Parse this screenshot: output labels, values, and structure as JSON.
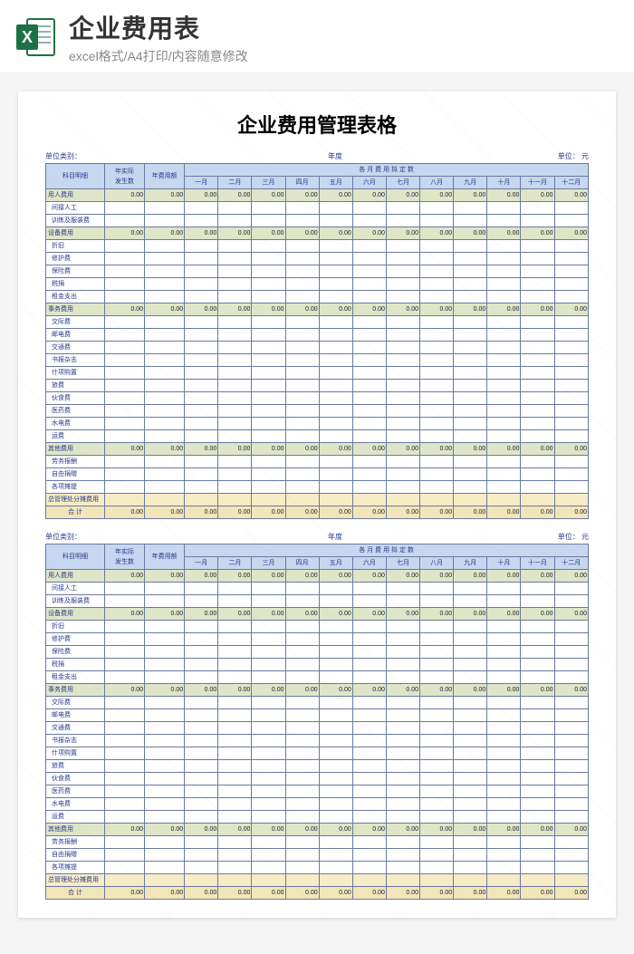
{
  "header": {
    "icon_label": "X",
    "main_title": "企业费用表",
    "sub_title": "excel格式/A4打印/内容随意修改"
  },
  "doc_title": "企业费用管理表格",
  "meta": {
    "unit_label": "单位类别：",
    "year_label": "年度",
    "currency_label": "单位：    元"
  },
  "columns": {
    "item": "科目明细",
    "actual": "年实际\n发生数",
    "budget": "年费用额",
    "months_group": "各 月 费 用 拟 定 数",
    "months": [
      "一月",
      "二月",
      "三月",
      "四月",
      "五月",
      "六月",
      "七月",
      "八月",
      "九月",
      "十月",
      "十一月",
      "十二月"
    ]
  },
  "zero": "0.00",
  "rows": [
    {
      "type": "section",
      "name": "用人费用",
      "zero": true
    },
    {
      "type": "detail",
      "name": "间接人工"
    },
    {
      "type": "detail",
      "name": "训练及服装费"
    },
    {
      "type": "section",
      "name": "设备费用",
      "zero": true
    },
    {
      "type": "detail",
      "name": "折旧"
    },
    {
      "type": "detail",
      "name": "修护费"
    },
    {
      "type": "detail",
      "name": "保险费"
    },
    {
      "type": "detail",
      "name": "税捐"
    },
    {
      "type": "detail",
      "name": "租金支出"
    },
    {
      "type": "section",
      "name": "事务费用",
      "zero": true
    },
    {
      "type": "detail",
      "name": "交际费"
    },
    {
      "type": "detail",
      "name": "邮电费"
    },
    {
      "type": "detail",
      "name": "交通费"
    },
    {
      "type": "detail",
      "name": "书报杂志"
    },
    {
      "type": "detail",
      "name": "什项购置"
    },
    {
      "type": "detail",
      "name": "旅费"
    },
    {
      "type": "detail",
      "name": "伙食费"
    },
    {
      "type": "detail",
      "name": "医药费"
    },
    {
      "type": "detail",
      "name": "水电费"
    },
    {
      "type": "detail",
      "name": "运费"
    },
    {
      "type": "section",
      "name": "其他费用",
      "zero": true
    },
    {
      "type": "detail",
      "name": "劳务报酬"
    },
    {
      "type": "detail",
      "name": "自由捐赠"
    },
    {
      "type": "detail",
      "name": "各项摊提"
    },
    {
      "type": "highlight",
      "name": "总管理处分摊费用"
    },
    {
      "type": "total",
      "name": "合  计",
      "zero": true
    }
  ]
}
